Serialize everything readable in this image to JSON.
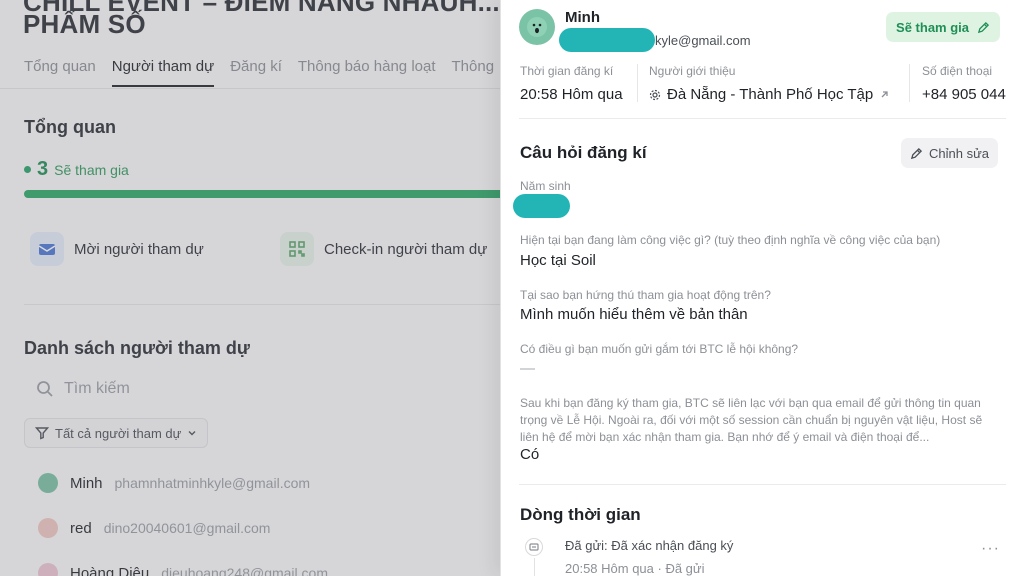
{
  "background": {
    "title_line1": "CHILL EVENT – ĐIỂM NÀNG NHAUH...",
    "title_line2": "PHẨM SỐ",
    "tabs": [
      {
        "label": "Tổng quan",
        "active": false
      },
      {
        "label": "Người tham dự",
        "active": true
      },
      {
        "label": "Đăng kí",
        "active": false
      },
      {
        "label": "Thông báo hàng loạt",
        "active": false
      },
      {
        "label": "Thông",
        "active": false
      }
    ],
    "overview_title": "Tổng quan",
    "going_count": "3",
    "going_label": "Sẽ tham gia",
    "actions": {
      "invite": "Mời người tham dự",
      "checkin": "Check-in người tham dự"
    },
    "guest_list_title": "Danh sách người tham dự",
    "search_placeholder": "Tìm kiếm",
    "filter_label": "Tất cả người tham dự",
    "people": [
      {
        "name": "Minh",
        "email": "phamnhatminhkyle@gmail.com"
      },
      {
        "name": "red",
        "email": "dino20040601@gmail.com"
      },
      {
        "name": "Hoàng Diệu",
        "email": "dieuhoang248@gmail.com"
      }
    ]
  },
  "panel": {
    "name": "Minh",
    "email_suffix": "kyle@gmail.com",
    "status_button": "Sẽ tham gia",
    "meta": {
      "registered_label": "Thời gian đăng kí",
      "registered_value": "20:58 Hôm qua",
      "referrer_label": "Người giới thiệu",
      "referrer_value": "Đà Nẵng - Thành Phố Học Tập",
      "phone_label": "Số điện thoại",
      "phone_value": "+84 905 044"
    },
    "questions_title": "Câu hỏi đăng kí",
    "edit_button": "Chỉnh sửa",
    "questions": [
      {
        "q": "Năm sinh",
        "a": ""
      },
      {
        "q": "Hiện tại bạn đang làm công việc gì? (tuỳ theo định nghĩa về công việc của bạn)",
        "a": "Học tại Soil"
      },
      {
        "q": "Tại sao bạn hứng thú tham gia hoạt động trên?",
        "a": "Mình muốn hiểu thêm về bản thân"
      },
      {
        "q": "Có điều gì bạn muốn gửi gắm tới BTC lễ hội không?",
        "a": "—"
      },
      {
        "q": "Sau khi bạn đăng ký tham gia, BTC sẽ liên lạc với bạn qua email để gửi thông tin quan trọng về Lễ Hội. Ngoài ra, đối với một số session cần chuẩn bị nguyên vật liệu, Host sẽ liên hệ để mời bạn xác nhận tham gia. Bạn nhớ để ý email và điện thoại để...",
        "a": "Có"
      }
    ],
    "timeline_title": "Dòng thời gian",
    "timeline": [
      {
        "title": "Đã gửi: Đã xác nhận đăng ký",
        "sub": "20:58 Hôm qua · Đã gửi"
      }
    ],
    "more": "···"
  },
  "colors": {
    "accent_green": "#1f8f56",
    "redaction": "#23b5b5"
  }
}
